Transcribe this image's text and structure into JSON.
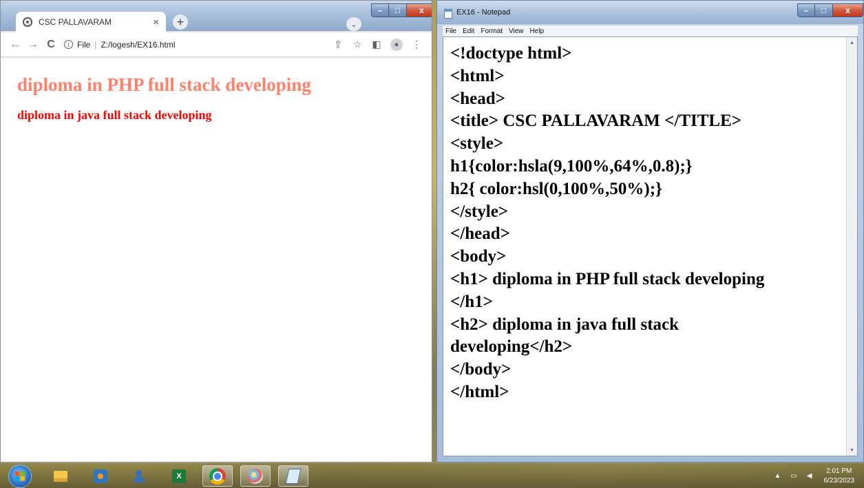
{
  "chrome": {
    "tab_title": "CSC PALLAVARAM",
    "tab_close": "×",
    "new_tab": "+",
    "tab_menu": "⌄",
    "address_scheme": "File",
    "address_url": "Z:/logesh/EX16.html",
    "page": {
      "h1": "diploma in PHP full stack developing",
      "h2": "diploma in java full stack developing"
    }
  },
  "notepad": {
    "title": "EX16 - Notepad",
    "menu": [
      "File",
      "Edit",
      "Format",
      "View",
      "Help"
    ],
    "content": "<!doctype html>\n<html>\n<head>\n<title> CSC PALLAVARAM </TITLE>\n<style>\nh1{color:hsla(9,100%,64%,0.8);}\nh2{ color:hsl(0,100%,50%);}\n</style>\n</head>\n<body>\n<h1> diploma in PHP full stack developing\n</h1>\n<h2> diploma in java full stack\ndeveloping</h2>\n</body>\n</html>"
  },
  "taskbar": {
    "clock_time": "2:01 PM",
    "clock_date": "6/23/2023",
    "icons": [
      "windows-start-icon",
      "file-explorer-icon",
      "media-player-icon",
      "people-icon",
      "excel-icon",
      "chrome-icon",
      "paint-icon",
      "notepad-icon"
    ]
  },
  "colors": {
    "h1_color": "hsla(9,100%,64%,0.8)",
    "h2_color": "hsl(0,100%,50%)"
  }
}
